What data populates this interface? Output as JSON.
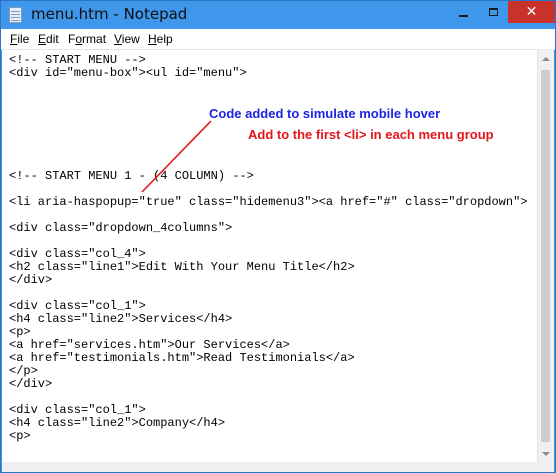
{
  "window": {
    "title": "menu.htm - Notepad",
    "close_glyph": "✕",
    "icon": "notepad-icon"
  },
  "menubar": {
    "file_u": "F",
    "file_rest": "ile",
    "edit_u": "E",
    "edit_rest": "dit",
    "format_pre": "F",
    "format_u": "o",
    "format_rest": "rmat",
    "view_u": "V",
    "view_rest": "iew",
    "help_u": "H",
    "help_rest": "elp"
  },
  "editor": {
    "lines": [
      "<!-- START MENU -->",
      "<div id=\"menu-box\"><ul id=\"menu\">",
      "",
      "",
      "",
      "",
      "",
      "",
      "<!-- START MENU 1 - (4 COLUMN) -->",
      "",
      "<li aria-haspopup=\"true\" class=\"hidemenu3\"><a href=\"#\" class=\"dropdown\">",
      "",
      "<div class=\"dropdown_4columns\">",
      "",
      "<div class=\"col_4\">",
      "<h2 class=\"line1\">Edit With Your Menu Title</h2>",
      "</div>",
      "",
      "<div class=\"col_1\">",
      "<h4 class=\"line2\">Services</h4>",
      "<p>",
      "<a href=\"services.htm\">Our Services</a>",
      "<a href=\"testimonials.htm\">Read Testimonials</a>",
      "</p>",
      "</div>",
      "",
      "<div class=\"col_1\">",
      "<h4 class=\"line2\">Company</h4>",
      "<p>"
    ]
  },
  "annotations": {
    "blue_note": "Code added to simulate mobile hover",
    "red_note": "Add to the first <li> in each menu group",
    "blue_color": "#1a25e6",
    "red_color": "#e3161c"
  },
  "colors": {
    "titlebar": "#3e97ea",
    "close_button": "#c9322a"
  }
}
